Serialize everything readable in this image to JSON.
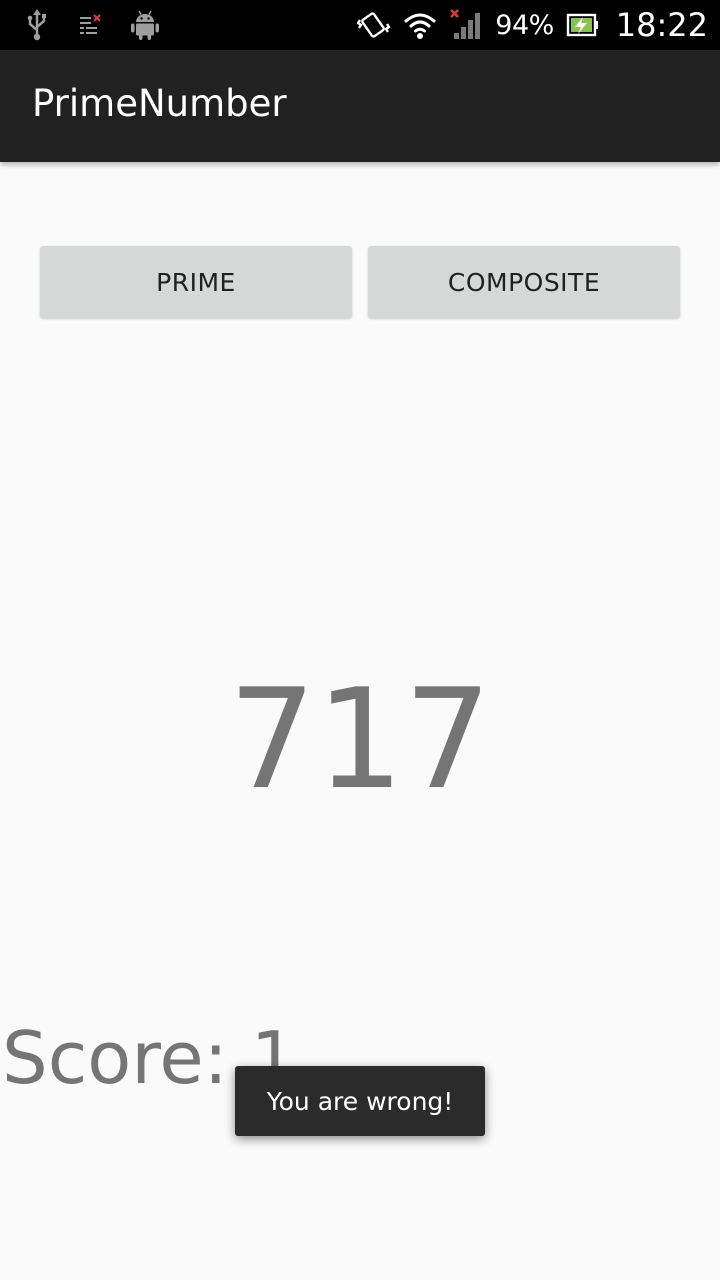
{
  "status_bar": {
    "left_icons": [
      "usb-icon",
      "notification-list-icon",
      "android-debug-icon"
    ],
    "right_icons": [
      "vibrate-icon",
      "wifi-icon",
      "cell-signal-no-service-icon",
      "battery-charging-icon"
    ],
    "battery_percent": "94%",
    "time": "18:22"
  },
  "action_bar": {
    "title": "PrimeNumber"
  },
  "buttons": {
    "prime_label": "PRIME",
    "composite_label": "COMPOSITE"
  },
  "game": {
    "number": "717",
    "score_text": "Score: 1"
  },
  "toast": {
    "message": "You are wrong!"
  },
  "colors": {
    "action_bar": "#212121",
    "status_bar": "#000000",
    "background": "#fafafa",
    "button": "#d6d7d7",
    "number_text": "#757575",
    "toast_bg": "#2b2b2b"
  }
}
